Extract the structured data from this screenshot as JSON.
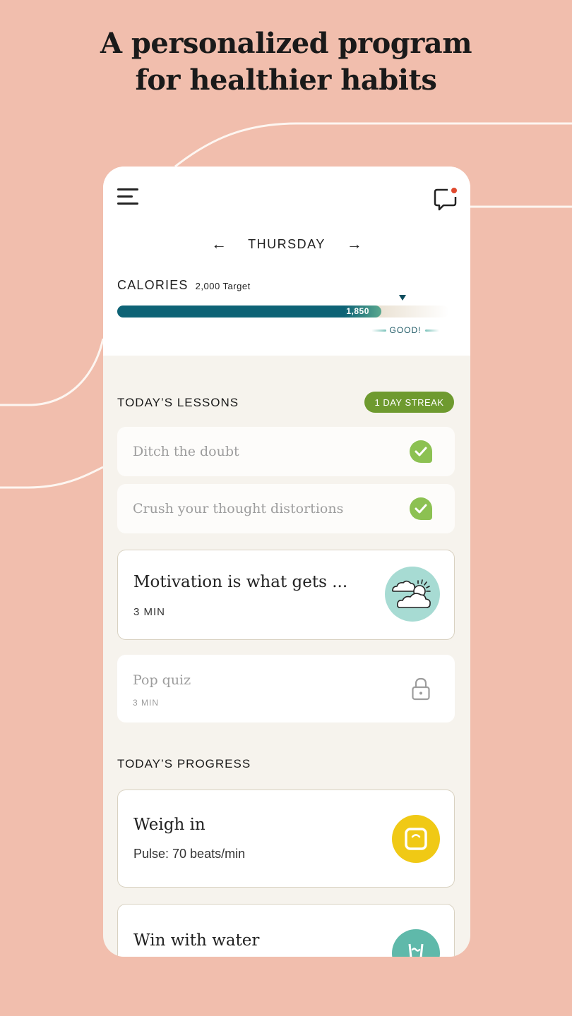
{
  "promo": {
    "headline_line1": "A personalized program",
    "headline_line2": "for healthier habits"
  },
  "header": {
    "menu_icon": "hamburger-menu-icon",
    "chat_icon": "chat-bubble-icon",
    "chat_has_notification": true,
    "prev_icon": "arrow-left-icon",
    "next_icon": "arrow-right-icon",
    "day": "THURSDAY"
  },
  "calories": {
    "title": "CALORIES",
    "target_label": "2,000 Target",
    "target": 2000,
    "consumed": 1850,
    "consumed_label": "1,850",
    "status": "GOOD!"
  },
  "lessons": {
    "heading": "TODAY’S LESSONS",
    "streak": "1 DAY STREAK",
    "items": [
      {
        "title": "Ditch the doubt",
        "status": "completed",
        "icon": "check-icon"
      },
      {
        "title": "Crush your thought distortions",
        "status": "completed",
        "icon": "check-icon"
      },
      {
        "title": "Motivation is what gets ...",
        "duration": "3 MIN",
        "status": "current",
        "icon": "sun-clouds-icon"
      },
      {
        "title": "Pop quiz",
        "duration": "3 MIN",
        "status": "locked",
        "icon": "lock-icon"
      }
    ]
  },
  "progress": {
    "heading": "TODAY’S PROGRESS",
    "items": [
      {
        "title": "Weigh in",
        "subtitle": "Pulse: 70 beats/min",
        "icon": "scale-icon"
      },
      {
        "title": "Win with water",
        "icon": "water-glass-icon"
      }
    ]
  },
  "colors": {
    "background": "#f1bead",
    "teal": "#0e6376",
    "streak_green": "#6e9a2f",
    "check_green": "#8cc152",
    "notification_red": "#e04a2f",
    "scale_yellow": "#f0c915",
    "water_teal": "#5fb9aa",
    "weather_mint": "#a7dbd3"
  }
}
